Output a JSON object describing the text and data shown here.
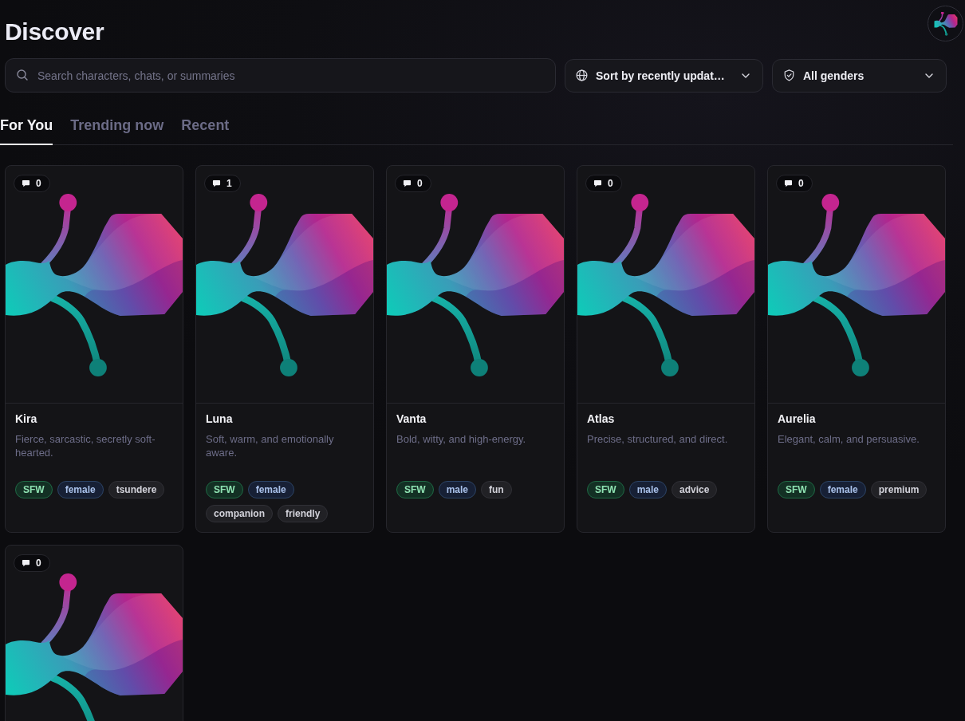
{
  "page": {
    "title": "Discover"
  },
  "search": {
    "placeholder": "Search characters, chats, or summaries"
  },
  "filters": [
    {
      "kind": "sort",
      "label": "Sort by recently updat…"
    },
    {
      "kind": "gender",
      "label": "All genders"
    }
  ],
  "tabs": [
    {
      "label": "For You",
      "selected": true
    },
    {
      "label": "Trending now",
      "selected": false
    },
    {
      "label": "Recent",
      "selected": false
    }
  ],
  "characters": [
    {
      "comment_count": "0",
      "name": "Kira",
      "description": "Fierce, sarcastic, secretly soft-hearted.",
      "tags": [
        {
          "label": "SFW",
          "kind": "rating"
        },
        {
          "label": "female",
          "kind": "gender"
        },
        {
          "label": "tsundere",
          "kind": "topic"
        }
      ]
    },
    {
      "comment_count": "1",
      "name": "Luna",
      "description": "Soft, warm, and emotionally aware.",
      "tags": [
        {
          "label": "SFW",
          "kind": "rating"
        },
        {
          "label": "female",
          "kind": "gender"
        },
        {
          "label": "companion",
          "kind": "topic"
        },
        {
          "label": "friendly",
          "kind": "topic"
        }
      ]
    },
    {
      "comment_count": "0",
      "name": "Vanta",
      "description": "Bold, witty, and high-energy.",
      "tags": [
        {
          "label": "SFW",
          "kind": "rating"
        },
        {
          "label": "male",
          "kind": "gender"
        },
        {
          "label": "fun",
          "kind": "topic"
        }
      ]
    },
    {
      "comment_count": "0",
      "name": "Atlas",
      "description": "Precise, structured, and direct.",
      "tags": [
        {
          "label": "SFW",
          "kind": "rating"
        },
        {
          "label": "male",
          "kind": "gender"
        },
        {
          "label": "advice",
          "kind": "topic"
        }
      ]
    },
    {
      "comment_count": "0",
      "name": "Aurelia",
      "description": "Elegant, calm, and persuasive.",
      "tags": [
        {
          "label": "SFW",
          "kind": "rating"
        },
        {
          "label": "female",
          "kind": "gender"
        },
        {
          "label": "premium",
          "kind": "topic"
        }
      ]
    },
    {
      "comment_count": "0"
    }
  ]
}
